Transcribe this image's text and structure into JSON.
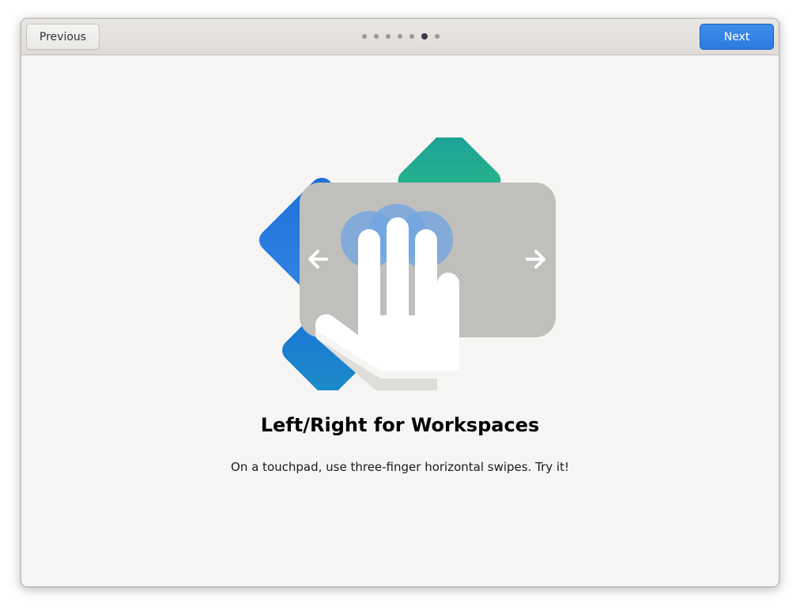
{
  "header": {
    "previous_label": "Previous",
    "next_label": "Next",
    "page_count": 7,
    "current_page": 6
  },
  "content": {
    "title": "Left/Right for Workspaces",
    "description": "On a touchpad, use three-finger horizontal swipes. Try it!"
  },
  "illustration": {
    "icons": [
      "touchpad-icon",
      "three-finger-hand-icon",
      "left-arrow-icon",
      "right-arrow-icon"
    ]
  },
  "colors": {
    "accent": "#3584e4",
    "touchpad": "#c0bfbc",
    "background": "#f6f5f4"
  }
}
